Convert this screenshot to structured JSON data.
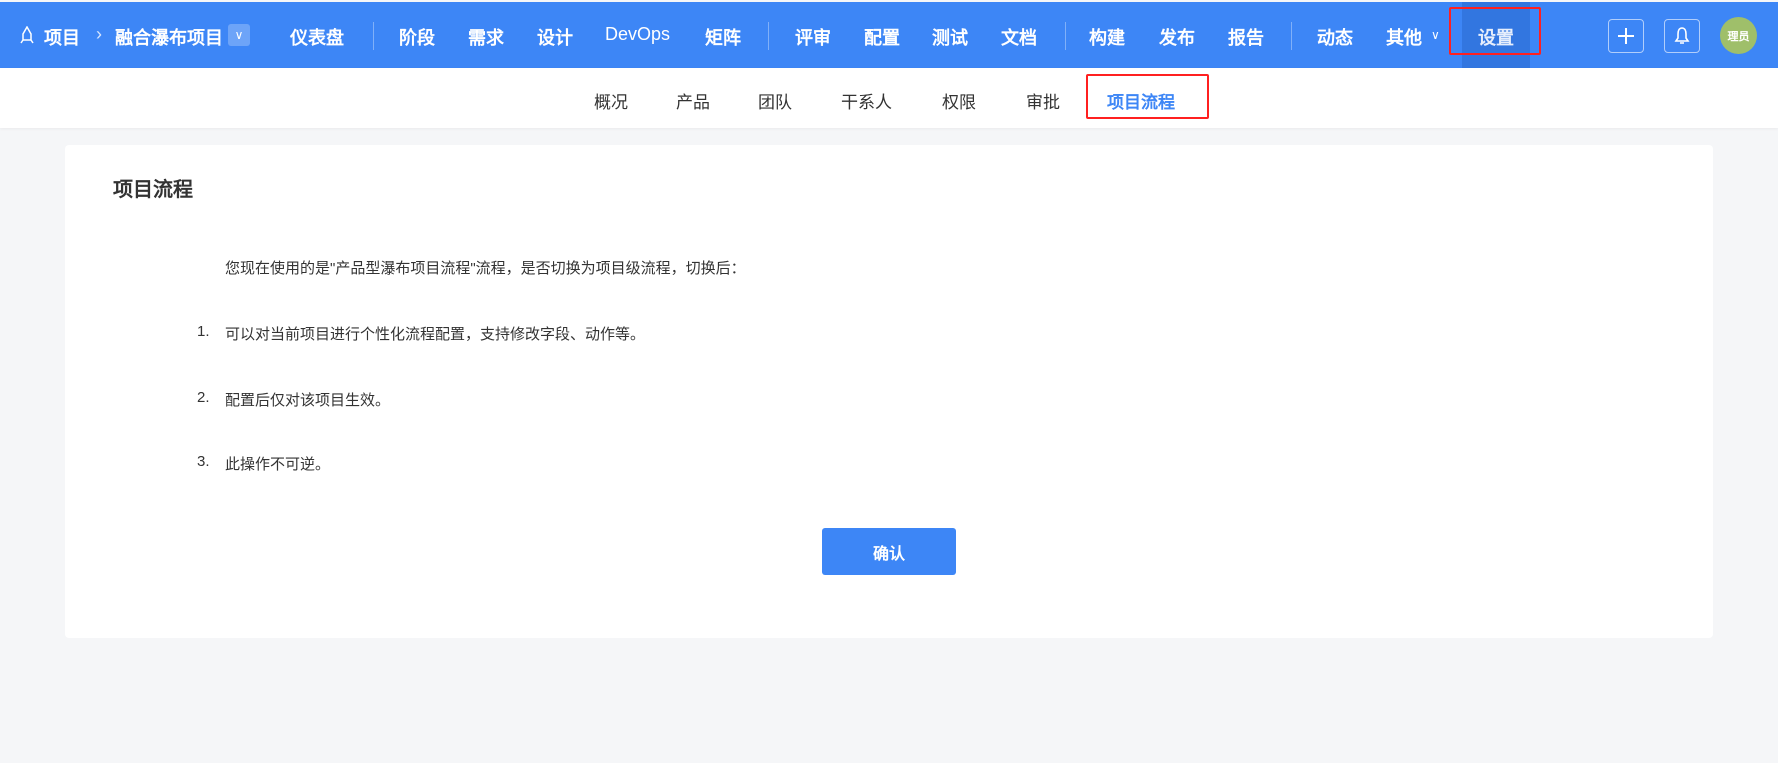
{
  "topbar": {
    "breadcrumb_root": "项目",
    "project_name": "融合瀑布项目",
    "nav": [
      "仪表盘",
      "阶段",
      "需求",
      "设计",
      "DevOps",
      "矩阵",
      "评审",
      "配置",
      "测试",
      "文档",
      "构建",
      "发布",
      "报告",
      "动态",
      "其他"
    ],
    "settings": "设置",
    "avatar_text": "理员"
  },
  "subnav": {
    "tabs": [
      "概况",
      "产品",
      "团队",
      "干系人",
      "权限",
      "审批",
      "项目流程"
    ],
    "active": "项目流程"
  },
  "main": {
    "title": "项目流程",
    "intro": "您现在使用的是\"产品型瀑布项目流程\"流程，是否切换为项目级流程，切换后：",
    "items": [
      {
        "num": "1.",
        "text": "可以对当前项目进行个性化流程配置，支持修改字段、动作等。"
      },
      {
        "num": "2.",
        "text": "配置后仅对该项目生效。"
      },
      {
        "num": "3.",
        "text": "此操作不可逆。"
      }
    ],
    "confirm": "确认"
  },
  "colors": {
    "brand": "#3d86f6",
    "highlight": "#ff2020"
  }
}
